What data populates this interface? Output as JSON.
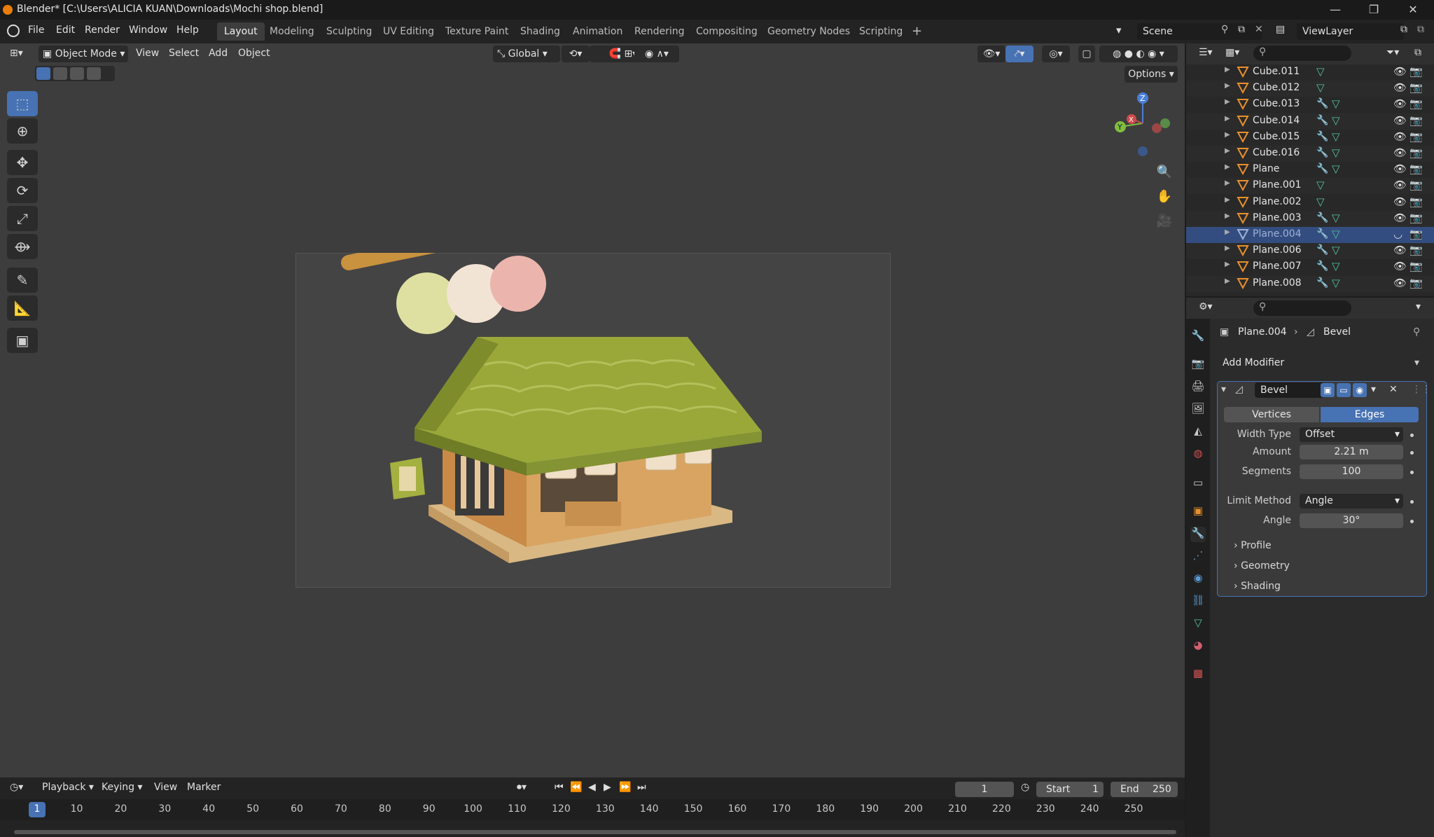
{
  "window": {
    "title": "Blender* [C:\\Users\\ALICIA KUAN\\Downloads\\Mochi shop.blend]",
    "minimize": "—",
    "maximize": "❐",
    "close": "✕"
  },
  "menubar": {
    "menus": [
      "File",
      "Edit",
      "Render",
      "Window",
      "Help"
    ],
    "workspaces": [
      "Layout",
      "Modeling",
      "Sculpting",
      "UV Editing",
      "Texture Paint",
      "Shading",
      "Animation",
      "Rendering",
      "Compositing",
      "Geometry Nodes",
      "Scripting"
    ],
    "active_workspace": "Layout",
    "add_tab": "+",
    "scene": "Scene",
    "view_layer": "ViewLayer"
  },
  "viewport": {
    "mode": "Object Mode",
    "menus": [
      "View",
      "Select",
      "Add",
      "Object"
    ],
    "orientation": "Global",
    "options_label": "Options",
    "gizmo": {
      "x": "X",
      "y": "Y",
      "z": "Z"
    }
  },
  "outliner": {
    "rows": [
      {
        "name": "Cube.011",
        "modifier": false,
        "selected": false
      },
      {
        "name": "Cube.012",
        "modifier": false,
        "selected": false
      },
      {
        "name": "Cube.013",
        "modifier": true,
        "selected": false
      },
      {
        "name": "Cube.014",
        "modifier": true,
        "selected": false
      },
      {
        "name": "Cube.015",
        "modifier": true,
        "selected": false
      },
      {
        "name": "Cube.016",
        "modifier": true,
        "selected": false
      },
      {
        "name": "Plane",
        "modifier": true,
        "selected": false
      },
      {
        "name": "Plane.001",
        "modifier": false,
        "selected": false
      },
      {
        "name": "Plane.002",
        "modifier": false,
        "selected": false
      },
      {
        "name": "Plane.003",
        "modifier": true,
        "selected": false
      },
      {
        "name": "Plane.004",
        "modifier": true,
        "selected": true
      },
      {
        "name": "Plane.006",
        "modifier": true,
        "selected": false
      },
      {
        "name": "Plane.007",
        "modifier": true,
        "selected": false
      },
      {
        "name": "Plane.008",
        "modifier": true,
        "selected": false
      }
    ]
  },
  "properties": {
    "breadcrumb_object": "Plane.004",
    "breadcrumb_sep": "›",
    "breadcrumb_modifier": "Bevel",
    "add_modifier": "Add Modifier",
    "modifier_name": "Bevel",
    "affect_vertices": "Vertices",
    "affect_edges": "Edges",
    "width_type_label": "Width Type",
    "width_type_value": "Offset",
    "amount_label": "Amount",
    "amount_value": "2.21 m",
    "segments_label": "Segments",
    "segments_value": "100",
    "limit_method_label": "Limit Method",
    "limit_method_value": "Angle",
    "angle_label": "Angle",
    "angle_value": "30°",
    "panels": [
      "Profile",
      "Geometry",
      "Shading"
    ]
  },
  "timeline": {
    "menus": [
      "Playback",
      "Keying",
      "View",
      "Marker"
    ],
    "current_frame": "1",
    "start_label": "Start",
    "start_value": "1",
    "end_label": "End",
    "end_value": "250",
    "ruler": [
      "1",
      "10",
      "20",
      "30",
      "40",
      "50",
      "60",
      "70",
      "80",
      "90",
      "100",
      "110",
      "120",
      "130",
      "140",
      "150",
      "160",
      "170",
      "180",
      "190",
      "200",
      "210",
      "220",
      "230",
      "240",
      "250"
    ]
  },
  "colors": {
    "accent": "#4772b3",
    "selection": "#334d80",
    "roof": "#9aa83a",
    "wall": "#d4a062",
    "mochi_green": "#dde0a0",
    "mochi_white": "#f2e4d4",
    "mochi_pink": "#ebb5ad"
  }
}
